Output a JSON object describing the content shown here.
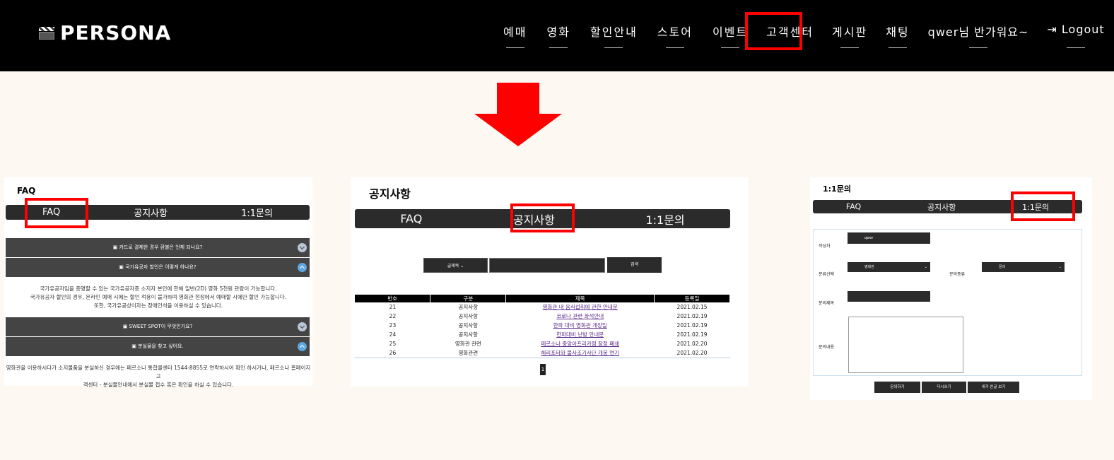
{
  "header": {
    "brand": "PERSONA",
    "nav": [
      "예매",
      "영화",
      "할인안내",
      "스토어",
      "이벤트",
      "고객센터",
      "게시판",
      "채팅",
      "qwer님 반가워요~",
      "Logout"
    ],
    "logout_icon": "sign-out-icon"
  },
  "colors": {
    "highlight": "#ff0000",
    "topbar": "#000000",
    "background": "#fdf8f1"
  },
  "faq": {
    "title": "FAQ",
    "tabs": [
      "FAQ",
      "공지사항",
      "1:1문의"
    ],
    "questions": [
      "▣ 카드로 결제한 경우 환불은 언제 되나요?",
      "▣ 국가유공자 할인은 어떻게 하나요?",
      "▣ SWEET SPOT이 무엇인가요?",
      "▣ 분실물을 찾고 싶어요."
    ],
    "answer1": [
      "국가유공자임을 증명할 수 있는 국가유공자증 소지자 본인에 한해 일반(2D) 영화 5천원 관람이 가능합니다.",
      "국가유공자 할인의 경우, 온라인 예매 시에는 할인 적용이 불가하며 영화관 현장에서 예매할 시에만 할인 가능합니다.",
      "또한, 국가유공상이자는 장애인석을 이용하실 수 있습니다."
    ],
    "answer2": [
      "영화관을 이용하시다가 소지물품을 분실하신 경우에는 페르소나 통합콜센터 1544-8855로 연락하시어 확인 하시거나, 페르소나 홈페이지 고",
      "객센터 - 분실물안내에서 분실물 접수 혹은 확인을 하실 수 있습니다."
    ]
  },
  "notice": {
    "title": "공지사항",
    "tabs": [
      "FAQ",
      "공지사항",
      "1:1문의"
    ],
    "search_option": "글제목",
    "search_button": "검색",
    "columns": [
      "번호",
      "구분",
      "제목",
      "등록일"
    ],
    "rows": [
      [
        "21",
        "공지사항",
        "영화관 내 음식섭취에 관한 안내문",
        "2021.02.15"
      ],
      [
        "22",
        "공지사항",
        "코로나 관련 좌석안내",
        "2021.02.19"
      ],
      [
        "23",
        "공지사항",
        "한파 대비 영화관 개장일",
        "2021.02.19"
      ],
      [
        "24",
        "공지사항",
        "한파대비 난방 안내문",
        "2021.02.19"
      ],
      [
        "25",
        "영화관 관련",
        "페르소나 중앙아프리카점 잠정 폐쇄",
        "2021.02.20"
      ],
      [
        "26",
        "영화관련",
        "해리포터와 불사조기사단 개봉 연기",
        "2021.02.20"
      ]
    ],
    "page": "1"
  },
  "inquiry": {
    "title": "1:1문의",
    "tabs": [
      "FAQ",
      "공지사항",
      "1:1문의"
    ],
    "labels": {
      "writer": "작성자",
      "category": "분류선택",
      "type": "문의종류",
      "subject": "문의제목",
      "content": "문의내용"
    },
    "writer_value": "qwer",
    "category_value": "영화관",
    "type_value": "문의",
    "buttons": [
      "문의하기",
      "다시쓰기",
      "내가 쓴글 보기"
    ]
  }
}
